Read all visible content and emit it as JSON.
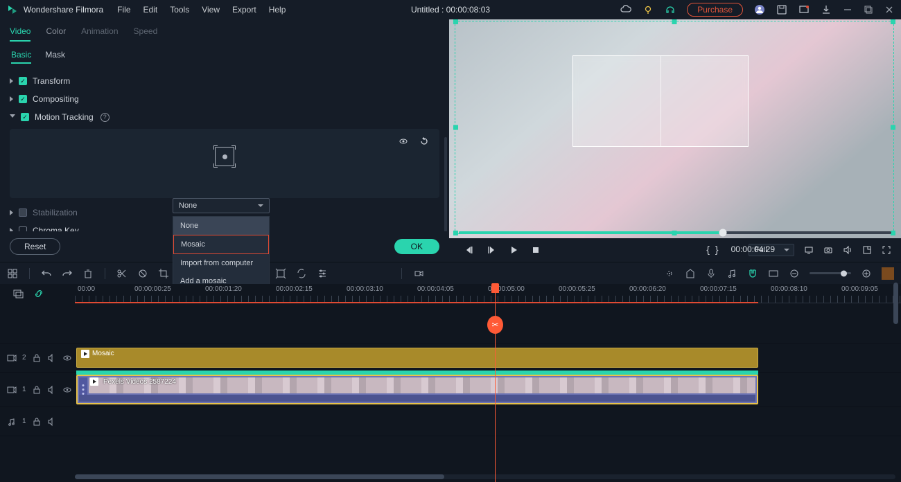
{
  "app": {
    "name": "Wondershare Filmora"
  },
  "menu": [
    "File",
    "Edit",
    "Tools",
    "View",
    "Export",
    "Help"
  ],
  "document": {
    "title": "Untitled : 00:00:08:03"
  },
  "top_right": {
    "purchase": "Purchase"
  },
  "left_panel": {
    "tabs": [
      "Video",
      "Color",
      "Animation",
      "Speed"
    ],
    "subtabs": [
      "Basic",
      "Mask"
    ],
    "sections": {
      "transform": "Transform",
      "compositing": "Compositing",
      "motion_tracking": "Motion Tracking",
      "stabilization": "Stabilization",
      "chroma_key": "Chroma Key"
    },
    "dropdown": {
      "selected": "None",
      "items": [
        "None",
        "Mosaic",
        "Import from computer",
        "Add a mosaic"
      ]
    },
    "reset": "Reset",
    "ok": "OK"
  },
  "preview": {
    "timecode": "00:00:04:29",
    "quality": "Full"
  },
  "timeline": {
    "ruler": [
      "00:00",
      "00:00:00:25",
      "00:00:01:20",
      "00:00:02:15",
      "00:00:03:10",
      "00:00:04:05",
      "00:00:05:00",
      "00:00:05:25",
      "00:00:06:20",
      "00:00:07:15",
      "00:00:08:10",
      "00:00:09:05"
    ],
    "tracks": {
      "t1": {
        "label": "2",
        "clip": "Mosaic"
      },
      "t2": {
        "label": "1",
        "clip": "Pexels Videos 2587224"
      },
      "t3": {
        "label": "1"
      }
    }
  }
}
